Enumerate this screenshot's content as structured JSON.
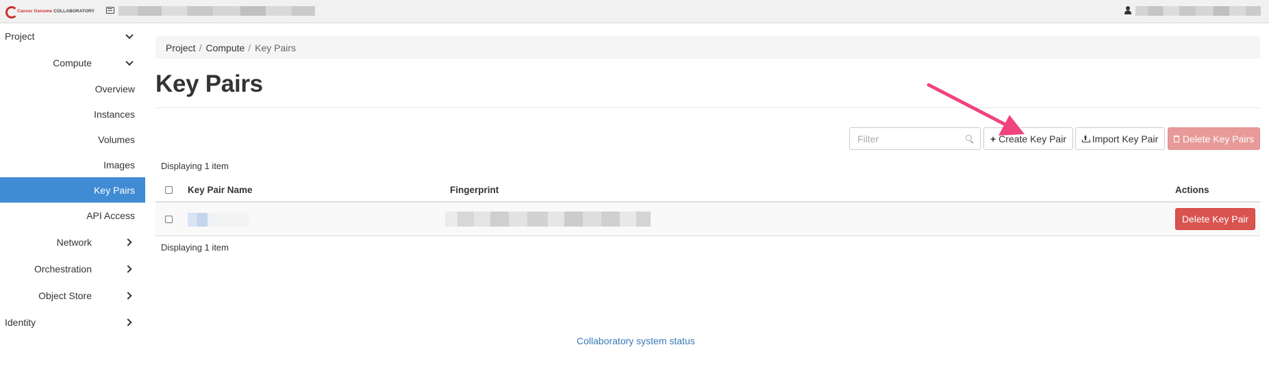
{
  "topbar": {
    "brand_part1": "Cancer Genome",
    "brand_part2": "COLLABORATORY"
  },
  "sidebar": {
    "items": [
      {
        "label": "Project"
      },
      {
        "label": "Compute"
      },
      {
        "label": "Overview"
      },
      {
        "label": "Instances"
      },
      {
        "label": "Volumes"
      },
      {
        "label": "Images"
      },
      {
        "label": "Key Pairs",
        "active": true
      },
      {
        "label": "API Access"
      },
      {
        "label": "Network"
      },
      {
        "label": "Orchestration"
      },
      {
        "label": "Object Store"
      },
      {
        "label": "Identity"
      }
    ]
  },
  "breadcrumb": {
    "items": [
      "Project",
      "Compute",
      "Key Pairs"
    ],
    "separator": "/"
  },
  "page": {
    "title": "Key Pairs"
  },
  "toolbar": {
    "filter_placeholder": "Filter",
    "create_label": "Create Key Pair",
    "import_label": "Import Key Pair",
    "delete_all_label": "Delete Key Pairs"
  },
  "table": {
    "display_count": "Displaying 1 item",
    "columns": [
      "Key Pair Name",
      "Fingerprint",
      "Actions"
    ],
    "rows": [
      {
        "action_label": "Delete Key Pair"
      }
    ]
  },
  "footer": {
    "status_link": "Collaboratory system status"
  },
  "colors": {
    "active_nav": "#3f8bd4",
    "danger": "#d9534f",
    "danger_disabled": "#e79a99",
    "link": "#3779b6",
    "annotation_arrow": "#f0447c"
  },
  "icons": {
    "brand": "collaboratory-logo-icon",
    "project_selector": "project-selector-icon",
    "user": "user-icon",
    "filter": "search-icon",
    "create": "plus-icon",
    "import": "upload-icon",
    "delete_all": "trash-icon"
  }
}
